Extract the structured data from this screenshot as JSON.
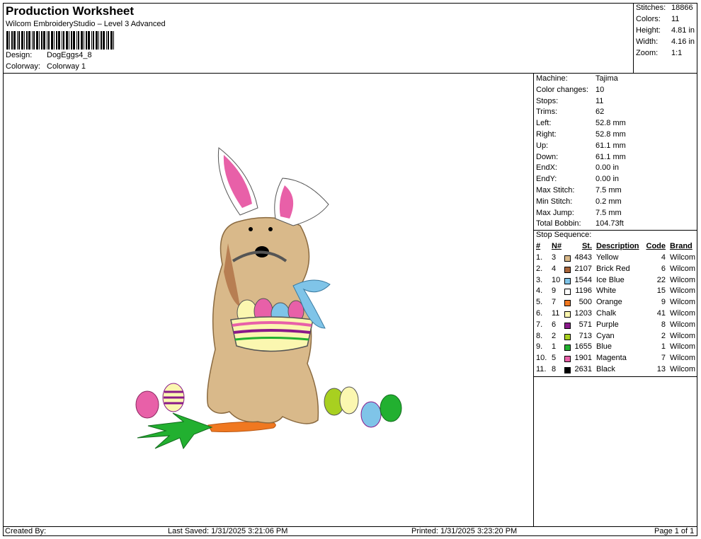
{
  "header": {
    "title": "Production Worksheet",
    "subtitle": "Wilcom EmbroideryStudio – Level 3 Advanced",
    "design_label": "Design:",
    "design_value": "DogEggs4_8",
    "colorway_label": "Colorway:",
    "colorway_value": "Colorway 1"
  },
  "stats": [
    {
      "label": "Stitches:",
      "value": "18866"
    },
    {
      "label": "Colors:",
      "value": "11"
    },
    {
      "label": "Height:",
      "value": "4.81 in"
    },
    {
      "label": "Width:",
      "value": "4.16 in"
    },
    {
      "label": "Zoom:",
      "value": "1:1"
    }
  ],
  "machine": [
    {
      "label": "Machine:",
      "value": "Tajima"
    },
    {
      "label": "Color changes:",
      "value": "10"
    },
    {
      "label": "Stops:",
      "value": "11"
    },
    {
      "label": "Trims:",
      "value": "62"
    },
    {
      "label": "Left:",
      "value": "52.8 mm"
    },
    {
      "label": "Right:",
      "value": "52.8 mm"
    },
    {
      "label": "Up:",
      "value": "61.1 mm"
    },
    {
      "label": "Down:",
      "value": "61.1 mm"
    },
    {
      "label": "EndX:",
      "value": "0.00 in"
    },
    {
      "label": "EndY:",
      "value": "0.00 in"
    },
    {
      "label": "Max Stitch:",
      "value": "7.5 mm"
    },
    {
      "label": "Min Stitch:",
      "value": "0.2 mm"
    },
    {
      "label": "Max Jump:",
      "value": "7.5 mm"
    },
    {
      "label": "Total Bobbin:",
      "value": "104.73ft"
    }
  ],
  "stop_sequence": {
    "title": "Stop Sequence:",
    "headers": {
      "num": "#",
      "n": "N#",
      "st": "St.",
      "desc": "Description",
      "code": "Code",
      "brand": "Brand"
    },
    "rows": [
      {
        "num": "1.",
        "n": "3",
        "st": "4843",
        "desc": "Yellow",
        "code": "4",
        "brand": "Wilcom",
        "color": "#d9b98a"
      },
      {
        "num": "2.",
        "n": "4",
        "st": "2107",
        "desc": "Brick Red",
        "code": "6",
        "brand": "Wilcom",
        "color": "#a8653a"
      },
      {
        "num": "3.",
        "n": "10",
        "st": "1544",
        "desc": "Ice Blue",
        "code": "22",
        "brand": "Wilcom",
        "color": "#7fc4e8"
      },
      {
        "num": "4.",
        "n": "9",
        "st": "1196",
        "desc": "White",
        "code": "15",
        "brand": "Wilcom",
        "color": "#ffffff"
      },
      {
        "num": "5.",
        "n": "7",
        "st": "500",
        "desc": "Orange",
        "code": "9",
        "brand": "Wilcom",
        "color": "#f07820"
      },
      {
        "num": "6.",
        "n": "11",
        "st": "1203",
        "desc": "Chalk",
        "code": "41",
        "brand": "Wilcom",
        "color": "#fbf7b0"
      },
      {
        "num": "7.",
        "n": "6",
        "st": "571",
        "desc": "Purple",
        "code": "8",
        "brand": "Wilcom",
        "color": "#8a1a8a"
      },
      {
        "num": "8.",
        "n": "2",
        "st": "713",
        "desc": "Cyan",
        "code": "2",
        "brand": "Wilcom",
        "color": "#a8d020"
      },
      {
        "num": "9.",
        "n": "1",
        "st": "1655",
        "desc": "Blue",
        "code": "1",
        "brand": "Wilcom",
        "color": "#22b030"
      },
      {
        "num": "10.",
        "n": "5",
        "st": "1901",
        "desc": "Magenta",
        "code": "7",
        "brand": "Wilcom",
        "color": "#e860a8"
      },
      {
        "num": "11.",
        "n": "8",
        "st": "2631",
        "desc": "Black",
        "code": "13",
        "brand": "Wilcom",
        "color": "#000000"
      }
    ]
  },
  "footer": {
    "created_by": "Created By:",
    "last_saved": "Last Saved: 1/31/2025 3:21:06 PM",
    "printed": "Printed: 1/31/2025 3:23:20 PM",
    "page": "Page 1 of 1"
  }
}
